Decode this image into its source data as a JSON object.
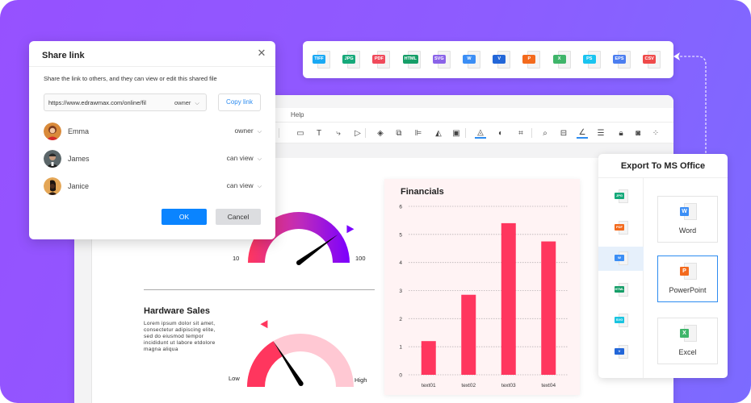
{
  "app": {
    "menu": {
      "help_label": "Help"
    },
    "toolbar_icons": [
      "rectangle-icon",
      "text-icon",
      "connector-icon",
      "pointer-icon",
      "layers-icon",
      "group-icon",
      "align-icon",
      "flip-icon",
      "frame-icon",
      "fill-color-icon",
      "shape-style-icon",
      "crop-icon",
      "search-icon",
      "find-replace-icon",
      "line-color-icon",
      "line-style-icon",
      "lock-icon",
      "fit-icon",
      "more-icon"
    ]
  },
  "share_dialog": {
    "title": "Share link",
    "description": "Share the link to others, and they can view or edit this shared file",
    "link_url": "https://www.edrawmax.com/online/fil",
    "link_permission": "owner",
    "copy_label": "Copy link",
    "users": [
      {
        "name": "Emma",
        "permission": "owner",
        "avatar_color": "#d98a3a"
      },
      {
        "name": "James",
        "permission": "can view",
        "avatar_color": "#3b4347"
      },
      {
        "name": "Janice",
        "permission": "can view",
        "avatar_color": "#e0a050"
      }
    ],
    "ok_label": "OK",
    "cancel_label": "Cancel"
  },
  "formats": [
    {
      "label": "TIFF",
      "color": "#1aa9f4"
    },
    {
      "label": "JPG",
      "color": "#16a97a"
    },
    {
      "label": "PDF",
      "color": "#f04a5b"
    },
    {
      "label": "HTML",
      "color": "#169e68"
    },
    {
      "label": "SVG",
      "color": "#8a63e8"
    },
    {
      "label": "W",
      "color": "#3b8ef5"
    },
    {
      "label": "V",
      "color": "#2266d8"
    },
    {
      "label": "P",
      "color": "#f36a1d"
    },
    {
      "label": "X",
      "color": "#3fb56a"
    },
    {
      "label": "PS",
      "color": "#19c4f0"
    },
    {
      "label": "EPS",
      "color": "#4c7ef0"
    },
    {
      "label": "CSV",
      "color": "#ef4a4a"
    }
  ],
  "export_panel": {
    "title": "Export To MS Office",
    "side_items": [
      {
        "label": "JPG",
        "color": "#16a97a"
      },
      {
        "label": "PDF",
        "color": "#f36a1d"
      },
      {
        "label": "W",
        "color": "#3b8ef5",
        "active": true
      },
      {
        "label": "HTML",
        "color": "#169e68"
      },
      {
        "label": "SVG",
        "color": "#19c4e0"
      },
      {
        "label": "V",
        "color": "#2266d8"
      }
    ],
    "cards": [
      {
        "label": "Word",
        "tag": "W",
        "color": "#3b8ef5"
      },
      {
        "label": "PowerPoint",
        "tag": "P",
        "color": "#f36a1d",
        "selected": true
      },
      {
        "label": "Excel",
        "tag": "X",
        "color": "#3fb56a"
      }
    ]
  },
  "canvas": {
    "gauge_top": {
      "min_label": "10",
      "max_label": "100",
      "value_fraction": 0.8
    },
    "hardware_sales": {
      "title": "Hardware Sales",
      "body": "Lorem  ipsum dolor sit amet, consectetur adipiscing elite, sed do eiusmod tempor incididunt ut labore etdolore magna aliqua"
    },
    "gauge_bottom": {
      "min_label": "Low",
      "max_label": "High",
      "value_fraction": 0.33
    }
  },
  "chart_data": {
    "type": "bar",
    "title": "Financials",
    "categories": [
      "text01",
      "text02",
      "text03",
      "text04"
    ],
    "values": [
      1.2,
      2.85,
      5.4,
      4.75
    ],
    "xlabel": "",
    "ylabel": "",
    "ylim": [
      0,
      6
    ],
    "yticks": [
      0,
      1,
      2,
      3,
      4,
      5,
      6
    ],
    "grid": true,
    "bar_color": "#ff365e"
  }
}
